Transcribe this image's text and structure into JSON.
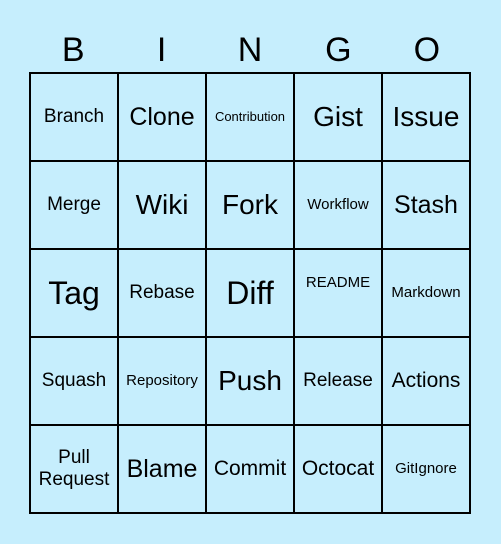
{
  "header": {
    "letters": [
      "B",
      "I",
      "N",
      "G",
      "O"
    ]
  },
  "cells": [
    {
      "label": "Branch",
      "size": "s-s"
    },
    {
      "label": "Clone",
      "size": "s-ml"
    },
    {
      "label": "Contribution",
      "size": "s-tiny"
    },
    {
      "label": "Gist",
      "size": "s-l"
    },
    {
      "label": "Issue",
      "size": "s-l"
    },
    {
      "label": "Merge",
      "size": "s-s"
    },
    {
      "label": "Wiki",
      "size": "s-l"
    },
    {
      "label": "Fork",
      "size": "s-l"
    },
    {
      "label": "Workflow",
      "size": "s-xxs"
    },
    {
      "label": "Stash",
      "size": "s-ml"
    },
    {
      "label": "Tag",
      "size": "s-xl"
    },
    {
      "label": "Rebase",
      "size": "s-s"
    },
    {
      "label": "Diff",
      "size": "s-xl"
    },
    {
      "label": "README",
      "size": "s-xxs",
      "offset": "up"
    },
    {
      "label": "Markdown",
      "size": "s-xxs"
    },
    {
      "label": "Squash",
      "size": "s-s"
    },
    {
      "label": "Repository",
      "size": "s-xxs"
    },
    {
      "label": "Push",
      "size": "s-l"
    },
    {
      "label": "Release",
      "size": "s-s"
    },
    {
      "label": "Actions",
      "size": "s-m"
    },
    {
      "label": "Pull Request",
      "size": "s-s"
    },
    {
      "label": "Blame",
      "size": "s-ml"
    },
    {
      "label": "Commit",
      "size": "s-m"
    },
    {
      "label": "Octocat",
      "size": "s-m"
    },
    {
      "label": "GitIgnore",
      "size": "s-xxs"
    }
  ]
}
